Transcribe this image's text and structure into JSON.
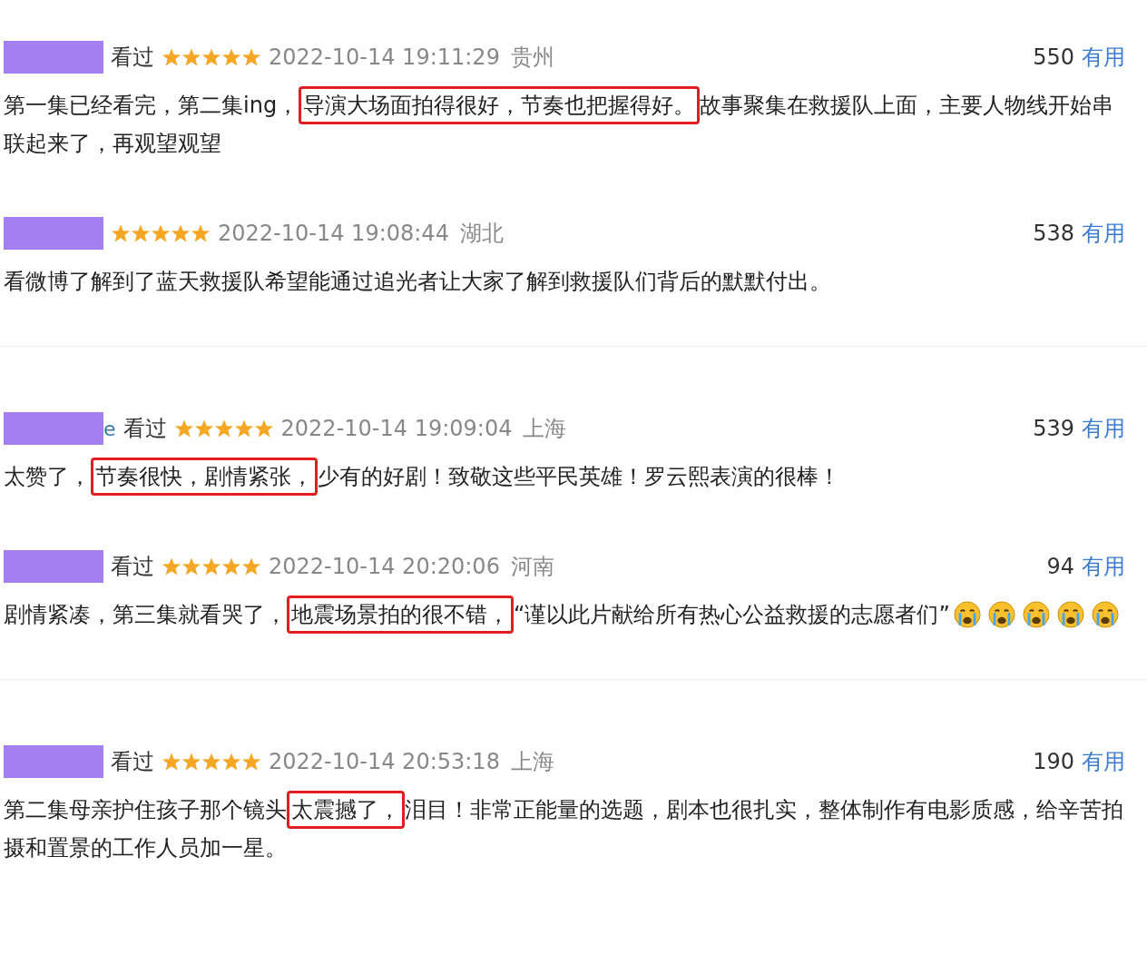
{
  "reviews": [
    {
      "redacted": true,
      "watched": "看过",
      "stars": 5,
      "time": "2022-10-14 19:11:29",
      "location": "贵州",
      "votes": "550",
      "useful": "有用",
      "separated": false,
      "body": [
        {
          "kind": "text",
          "text": "第一集已经看完，第二集ing，",
          "highlighted": false
        },
        {
          "kind": "text",
          "text": "导演大场面拍得很好，节奏也把握得好。",
          "highlighted": true
        },
        {
          "kind": "text",
          "text": "故事聚集在救援队上面，主要人物线开始串联起来了，再观望观望",
          "highlighted": false
        }
      ]
    },
    {
      "redacted": true,
      "stars": 5,
      "time": "2022-10-14 19:08:44",
      "location": "湖北",
      "votes": "538",
      "useful": "有用",
      "separated": true,
      "body": [
        {
          "kind": "text",
          "text": "看微博了解到了蓝天救援队希望能通过追光者让大家了解到救援队们背后的默默付出。",
          "highlighted": false
        }
      ]
    },
    {
      "redacted": true,
      "name_tail": "e",
      "watched": "看过",
      "stars": 5,
      "time": "2022-10-14 19:09:04",
      "location": "上海",
      "votes": "539",
      "useful": "有用",
      "separated": false,
      "body": [
        {
          "kind": "text",
          "text": "太赞了，",
          "highlighted": false
        },
        {
          "kind": "text",
          "text": "节奏很快，剧情紧张，",
          "highlighted": true
        },
        {
          "kind": "text",
          "text": "少有的好剧！致敬这些平民英雄！罗云熙表演的很棒！",
          "highlighted": false
        }
      ]
    },
    {
      "redacted": true,
      "watched": "看过",
      "stars": 5,
      "time": "2022-10-14 20:20:06",
      "location": "河南",
      "votes": "94",
      "useful": "有用",
      "separated": true,
      "body": [
        {
          "kind": "text",
          "text": "剧情紧凑，第三集就看哭了，",
          "highlighted": false
        },
        {
          "kind": "text",
          "text": "地震场景拍的很不错，",
          "highlighted": true
        },
        {
          "kind": "text",
          "text": "“谨以此片献给所有热心公益救援的志愿者们”",
          "highlighted": false
        },
        {
          "kind": "emoji"
        },
        {
          "kind": "emoji"
        },
        {
          "kind": "emoji"
        },
        {
          "kind": "emoji"
        },
        {
          "kind": "emoji"
        }
      ]
    },
    {
      "redacted": true,
      "watched": "看过",
      "stars": 5,
      "time": "2022-10-14 20:53:18",
      "location": "上海",
      "votes": "190",
      "useful": "有用",
      "separated": false,
      "body": [
        {
          "kind": "text",
          "text": "第二集母亲护住孩子那个镜头",
          "highlighted": false
        },
        {
          "kind": "text",
          "text": "太震撼了，",
          "highlighted": true
        },
        {
          "kind": "text",
          "text": "泪目！非常正能量的选题，剧本也很扎实，整体制作有电影质感，给辛苦拍摄和置景的工作人员加一星。",
          "highlighted": false
        }
      ]
    }
  ]
}
